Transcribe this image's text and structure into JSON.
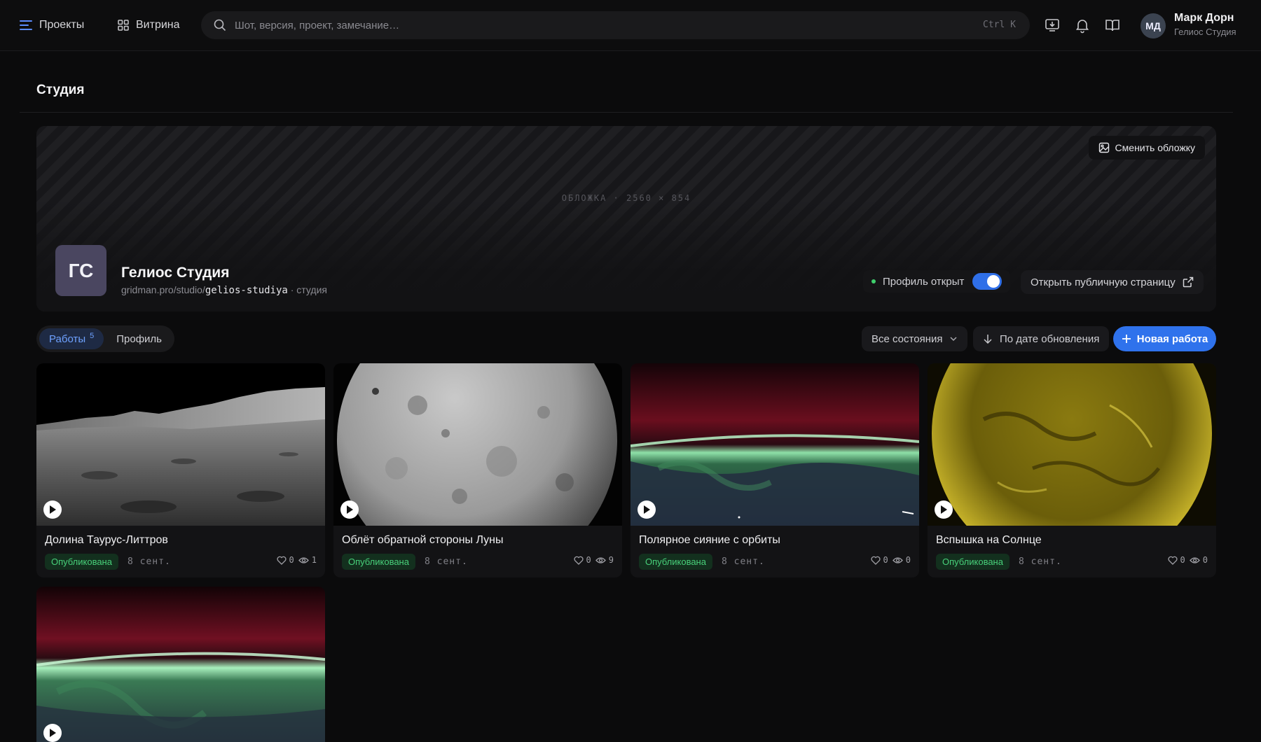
{
  "topbar": {
    "projects_label": "Проекты",
    "showcase_label": "Витрина",
    "search_placeholder": "Шот, версия, проект, замечание…",
    "search_shortcut": "Ctrl K",
    "user": {
      "initials": "МД",
      "name": "Марк Дорн",
      "org": "Гелиос Студия"
    }
  },
  "page": {
    "title": "Студия"
  },
  "cover": {
    "label": "ОБЛОЖКА · 2560 × 854",
    "change_label": "Сменить обложку"
  },
  "studio": {
    "initials": "ГС",
    "name": "Гелиос Студия",
    "url_prefix": "gridman.pro/studio/",
    "url_slug": "gelios-studiya",
    "url_suffix": " · студия",
    "profile_open_label": "Профиль открыт",
    "profile_open": true,
    "open_public_label": "Открыть публичную страницу"
  },
  "tabs": [
    {
      "label": "Работы",
      "count": "5",
      "active": true
    },
    {
      "label": "Профиль",
      "active": false
    }
  ],
  "filters": {
    "status_label": "Все состояния",
    "sort_label": "По дате обновления",
    "new_work_label": "Новая работа"
  },
  "works": [
    {
      "title": "Долина Таурус-Литтров",
      "status": "Опубликована",
      "date": "8 сент.",
      "likes": "0",
      "views": "1"
    },
    {
      "title": "Облёт обратной стороны Луны",
      "status": "Опубликована",
      "date": "8 сент.",
      "likes": "0",
      "views": "9"
    },
    {
      "title": "Полярное сияние с орбиты",
      "status": "Опубликована",
      "date": "8 сент.",
      "likes": "0",
      "views": "0"
    },
    {
      "title": "Вспышка на Солнце",
      "status": "Опубликована",
      "date": "8 сент.",
      "likes": "0",
      "views": "0"
    },
    {
      "title": "",
      "status": "",
      "date": "",
      "likes": "",
      "views": ""
    }
  ],
  "colors": {
    "accent": "#2f72ec",
    "published": "#48d07a",
    "background": "#0b0b0c"
  }
}
